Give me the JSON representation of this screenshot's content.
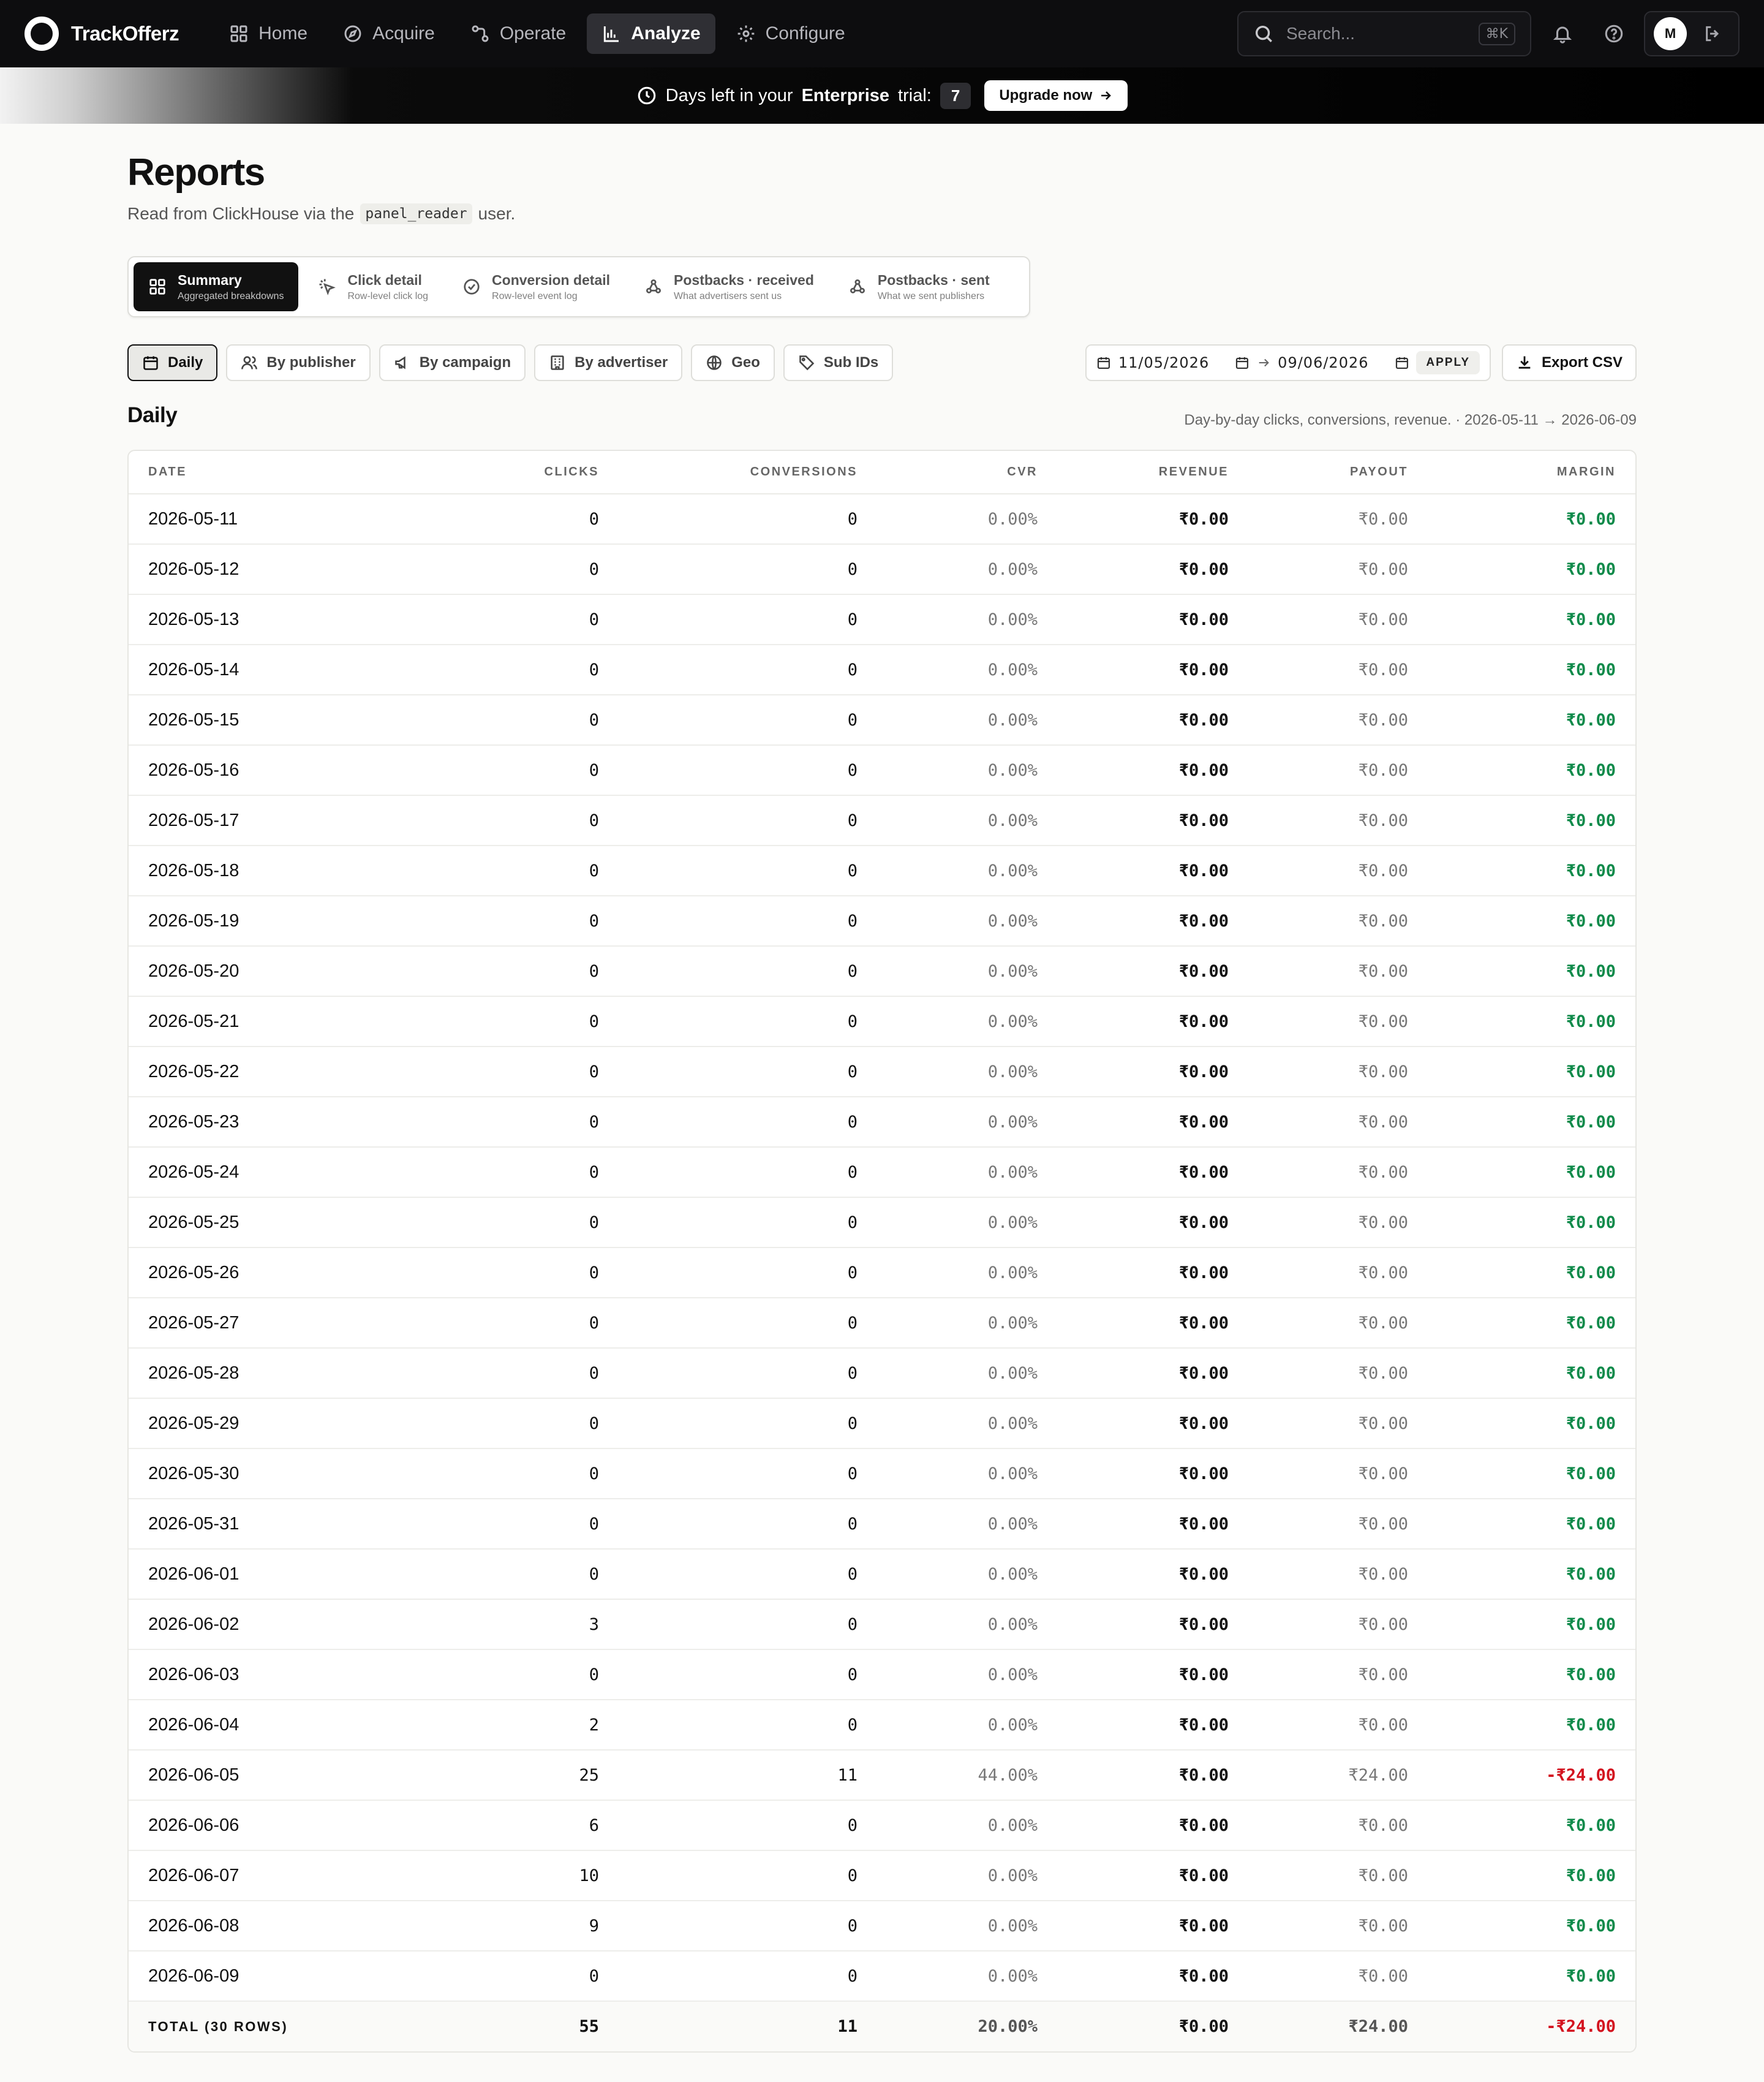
{
  "app": {
    "name": "TrackOfferz",
    "nav": [
      {
        "label": "Home",
        "icon": "grid-icon",
        "active": false
      },
      {
        "label": "Acquire",
        "icon": "compass-icon",
        "active": false
      },
      {
        "label": "Operate",
        "icon": "workflow-icon",
        "active": false
      },
      {
        "label": "Analyze",
        "icon": "bar-chart-icon",
        "active": true
      },
      {
        "label": "Configure",
        "icon": "gear-icon",
        "active": false
      }
    ],
    "search_placeholder": "Search...",
    "search_shortcut": "⌘K",
    "user_initial": "M"
  },
  "banner": {
    "prefix": "Days left in your",
    "plan": "Enterprise",
    "suffix": "trial:",
    "days": "7",
    "cta": "Upgrade now"
  },
  "page": {
    "title": "Reports",
    "subtitle_pre": "Read from ClickHouse via the",
    "subtitle_code": "panel_reader",
    "subtitle_post": "user."
  },
  "report_tabs": [
    {
      "label": "Summary",
      "desc": "Aggregated breakdowns",
      "icon": "grid-icon",
      "active": true
    },
    {
      "label": "Click detail",
      "desc": "Row-level click log",
      "icon": "cursor-click-icon",
      "active": false
    },
    {
      "label": "Conversion detail",
      "desc": "Row-level event log",
      "icon": "check-circle-icon",
      "active": false
    },
    {
      "label": "Postbacks · received",
      "desc": "What advertisers sent us",
      "icon": "webhook-icon",
      "active": false
    },
    {
      "label": "Postbacks · sent",
      "desc": "What we sent publishers",
      "icon": "webhook-icon",
      "active": false
    }
  ],
  "breakdowns": [
    {
      "label": "Daily",
      "icon": "calendar-icon",
      "active": true
    },
    {
      "label": "By publisher",
      "icon": "users-icon",
      "active": false
    },
    {
      "label": "By campaign",
      "icon": "megaphone-icon",
      "active": false
    },
    {
      "label": "By advertiser",
      "icon": "building-icon",
      "active": false
    },
    {
      "label": "Geo",
      "icon": "globe-icon",
      "active": false
    },
    {
      "label": "Sub IDs",
      "icon": "tag-icon",
      "active": false
    }
  ],
  "date_range": {
    "from": "11/05/2026",
    "to": "09/06/2026",
    "apply_label": "APPLY"
  },
  "export_label": "Export CSV",
  "section": {
    "title": "Daily",
    "meta": "Day-by-day clicks, conversions, revenue. · 2026-05-11 → 2026-06-09"
  },
  "table": {
    "columns": [
      "Date",
      "Clicks",
      "Conversions",
      "CVR",
      "Revenue",
      "Payout",
      "Margin"
    ],
    "rows": [
      [
        "2026-05-11",
        "0",
        "0",
        "0.00%",
        "₹0.00",
        "₹0.00",
        "₹0.00"
      ],
      [
        "2026-05-12",
        "0",
        "0",
        "0.00%",
        "₹0.00",
        "₹0.00",
        "₹0.00"
      ],
      [
        "2026-05-13",
        "0",
        "0",
        "0.00%",
        "₹0.00",
        "₹0.00",
        "₹0.00"
      ],
      [
        "2026-05-14",
        "0",
        "0",
        "0.00%",
        "₹0.00",
        "₹0.00",
        "₹0.00"
      ],
      [
        "2026-05-15",
        "0",
        "0",
        "0.00%",
        "₹0.00",
        "₹0.00",
        "₹0.00"
      ],
      [
        "2026-05-16",
        "0",
        "0",
        "0.00%",
        "₹0.00",
        "₹0.00",
        "₹0.00"
      ],
      [
        "2026-05-17",
        "0",
        "0",
        "0.00%",
        "₹0.00",
        "₹0.00",
        "₹0.00"
      ],
      [
        "2026-05-18",
        "0",
        "0",
        "0.00%",
        "₹0.00",
        "₹0.00",
        "₹0.00"
      ],
      [
        "2026-05-19",
        "0",
        "0",
        "0.00%",
        "₹0.00",
        "₹0.00",
        "₹0.00"
      ],
      [
        "2026-05-20",
        "0",
        "0",
        "0.00%",
        "₹0.00",
        "₹0.00",
        "₹0.00"
      ],
      [
        "2026-05-21",
        "0",
        "0",
        "0.00%",
        "₹0.00",
        "₹0.00",
        "₹0.00"
      ],
      [
        "2026-05-22",
        "0",
        "0",
        "0.00%",
        "₹0.00",
        "₹0.00",
        "₹0.00"
      ],
      [
        "2026-05-23",
        "0",
        "0",
        "0.00%",
        "₹0.00",
        "₹0.00",
        "₹0.00"
      ],
      [
        "2026-05-24",
        "0",
        "0",
        "0.00%",
        "₹0.00",
        "₹0.00",
        "₹0.00"
      ],
      [
        "2026-05-25",
        "0",
        "0",
        "0.00%",
        "₹0.00",
        "₹0.00",
        "₹0.00"
      ],
      [
        "2026-05-26",
        "0",
        "0",
        "0.00%",
        "₹0.00",
        "₹0.00",
        "₹0.00"
      ],
      [
        "2026-05-27",
        "0",
        "0",
        "0.00%",
        "₹0.00",
        "₹0.00",
        "₹0.00"
      ],
      [
        "2026-05-28",
        "0",
        "0",
        "0.00%",
        "₹0.00",
        "₹0.00",
        "₹0.00"
      ],
      [
        "2026-05-29",
        "0",
        "0",
        "0.00%",
        "₹0.00",
        "₹0.00",
        "₹0.00"
      ],
      [
        "2026-05-30",
        "0",
        "0",
        "0.00%",
        "₹0.00",
        "₹0.00",
        "₹0.00"
      ],
      [
        "2026-05-31",
        "0",
        "0",
        "0.00%",
        "₹0.00",
        "₹0.00",
        "₹0.00"
      ],
      [
        "2026-06-01",
        "0",
        "0",
        "0.00%",
        "₹0.00",
        "₹0.00",
        "₹0.00"
      ],
      [
        "2026-06-02",
        "3",
        "0",
        "0.00%",
        "₹0.00",
        "₹0.00",
        "₹0.00"
      ],
      [
        "2026-06-03",
        "0",
        "0",
        "0.00%",
        "₹0.00",
        "₹0.00",
        "₹0.00"
      ],
      [
        "2026-06-04",
        "2",
        "0",
        "0.00%",
        "₹0.00",
        "₹0.00",
        "₹0.00"
      ],
      [
        "2026-06-05",
        "25",
        "11",
        "44.00%",
        "₹0.00",
        "₹24.00",
        "-₹24.00"
      ],
      [
        "2026-06-06",
        "6",
        "0",
        "0.00%",
        "₹0.00",
        "₹0.00",
        "₹0.00"
      ],
      [
        "2026-06-07",
        "10",
        "0",
        "0.00%",
        "₹0.00",
        "₹0.00",
        "₹0.00"
      ],
      [
        "2026-06-08",
        "9",
        "0",
        "0.00%",
        "₹0.00",
        "₹0.00",
        "₹0.00"
      ],
      [
        "2026-06-09",
        "0",
        "0",
        "0.00%",
        "₹0.00",
        "₹0.00",
        "₹0.00"
      ]
    ],
    "total": [
      "TOTAL (30 ROWS)",
      "55",
      "11",
      "20.00%",
      "₹0.00",
      "₹24.00",
      "-₹24.00"
    ]
  },
  "colors": {
    "positive_margin": "#0f8a4a",
    "negative_margin": "#d3121e",
    "nav_bg": "#0d0d0f"
  }
}
